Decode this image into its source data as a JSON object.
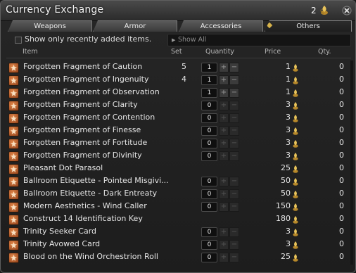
{
  "window": {
    "title": "Currency Exchange",
    "currency_count": "2",
    "currency_icon": "gil-coin-icon",
    "close_icon": "close-icon"
  },
  "tabs": [
    {
      "label": "Weapons",
      "active": false
    },
    {
      "label": "Armor",
      "active": false
    },
    {
      "label": "Accessories",
      "active": false
    },
    {
      "label": "Others",
      "active": true
    }
  ],
  "filter": {
    "checkbox_label": "Show only recently added items.",
    "checked": false,
    "dropdown_value": "Show All"
  },
  "columns": {
    "item": "Item",
    "set": "Set",
    "quantity": "Quantity",
    "price": "Price",
    "qty": "Qty."
  },
  "colors": {
    "accent_gold": "#d6b24a",
    "icon_orange": "#c96a30"
  },
  "rows": [
    {
      "name": "Forgotten Fragment of Caution",
      "set": "5",
      "quantity": "1",
      "price": "1",
      "qty": "0",
      "icon": "star-fragment-icon",
      "enabled": true
    },
    {
      "name": "Forgotten Fragment of Ingenuity",
      "set": "4",
      "quantity": "1",
      "price": "1",
      "qty": "0",
      "icon": "star-fragment-icon",
      "enabled": true
    },
    {
      "name": "Forgotten Fragment of Observation",
      "set": "",
      "quantity": "1",
      "price": "1",
      "qty": "0",
      "icon": "star-fragment-icon",
      "enabled": true
    },
    {
      "name": "Forgotten Fragment of Clarity",
      "set": "",
      "quantity": "0",
      "price": "3",
      "qty": "0",
      "icon": "star-fragment-icon",
      "enabled": false
    },
    {
      "name": "Forgotten Fragment of Contention",
      "set": "",
      "quantity": "0",
      "price": "3",
      "qty": "0",
      "icon": "star-fragment-icon",
      "enabled": false
    },
    {
      "name": "Forgotten Fragment of Finesse",
      "set": "",
      "quantity": "0",
      "price": "3",
      "qty": "0",
      "icon": "star-fragment-icon",
      "enabled": false
    },
    {
      "name": "Forgotten Fragment of Fortitude",
      "set": "",
      "quantity": "0",
      "price": "3",
      "qty": "0",
      "icon": "star-fragment-icon",
      "enabled": false
    },
    {
      "name": "Forgotten Fragment of Divinity",
      "set": "",
      "quantity": "0",
      "price": "3",
      "qty": "0",
      "icon": "star-fragment-icon",
      "enabled": false
    },
    {
      "name": "Pleasant Dot Parasol",
      "set": "",
      "quantity": "",
      "price": "25",
      "qty": "0",
      "icon": "box-icon",
      "enabled": false
    },
    {
      "name": "Ballroom Etiquette - Pointed Misgivi...",
      "set": "",
      "quantity": "0",
      "price": "50",
      "qty": "0",
      "icon": "book-icon",
      "enabled": false
    },
    {
      "name": "Ballroom Etiquette - Dark Entreaty",
      "set": "",
      "quantity": "0",
      "price": "50",
      "qty": "0",
      "icon": "book-icon",
      "enabled": false
    },
    {
      "name": "Modern Aesthetics - Wind Caller",
      "set": "",
      "quantity": "0",
      "price": "150",
      "qty": "0",
      "icon": "scroll-icon",
      "enabled": false
    },
    {
      "name": "Construct 14 Identification Key",
      "set": "",
      "quantity": "",
      "price": "180",
      "qty": "0",
      "icon": "key-icon",
      "enabled": false
    },
    {
      "name": "Trinity Seeker Card",
      "set": "",
      "quantity": "0",
      "price": "3",
      "qty": "0",
      "icon": "card-icon",
      "enabled": false
    },
    {
      "name": "Trinity Avowed Card",
      "set": "",
      "quantity": "0",
      "price": "3",
      "qty": "0",
      "icon": "card-icon",
      "enabled": false
    },
    {
      "name": "Blood on the Wind Orchestrion Roll",
      "set": "",
      "quantity": "0",
      "price": "25",
      "qty": "0",
      "icon": "music-roll-icon",
      "enabled": false
    }
  ]
}
